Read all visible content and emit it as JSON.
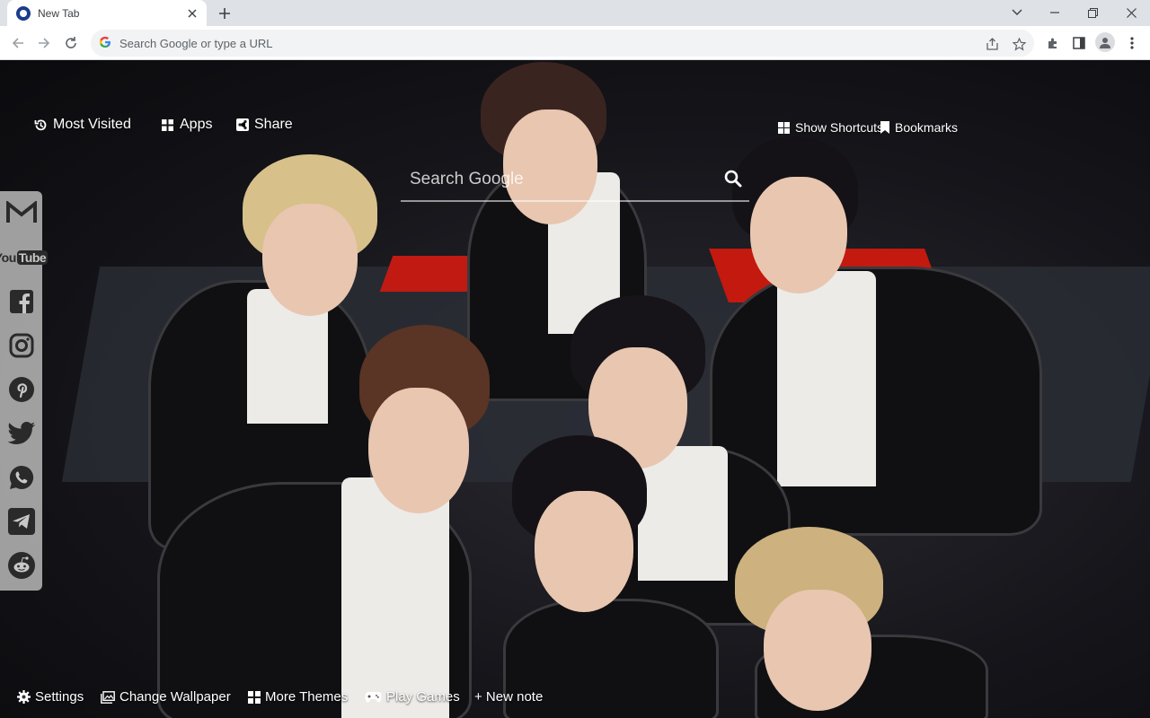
{
  "browser": {
    "tab_title": "New Tab",
    "omnibox_placeholder": "Search Google or type a URL"
  },
  "topbar": {
    "most_visited": "Most Visited",
    "apps": "Apps",
    "share": "Share",
    "show_shortcuts": "Show Shortcuts",
    "bookmarks": "Bookmarks"
  },
  "search": {
    "placeholder": "Search Google"
  },
  "social": [
    {
      "name": "gmail-icon"
    },
    {
      "name": "youtube-icon",
      "label": "You",
      "label2": "Tube"
    },
    {
      "name": "facebook-icon"
    },
    {
      "name": "instagram-icon"
    },
    {
      "name": "pinterest-icon"
    },
    {
      "name": "twitter-icon"
    },
    {
      "name": "whatsapp-icon"
    },
    {
      "name": "telegram-icon"
    },
    {
      "name": "reddit-icon"
    }
  ],
  "bottombar": {
    "settings": "Settings",
    "change_wallpaper": "Change Wallpaper",
    "more_themes": "More Themes",
    "play_games": "Play Games",
    "new_note": "+ New note"
  },
  "colors": {
    "tabstrip": "#dee1e6",
    "social_bar": "#c8c8c8",
    "accent_red": "#c3190f"
  }
}
